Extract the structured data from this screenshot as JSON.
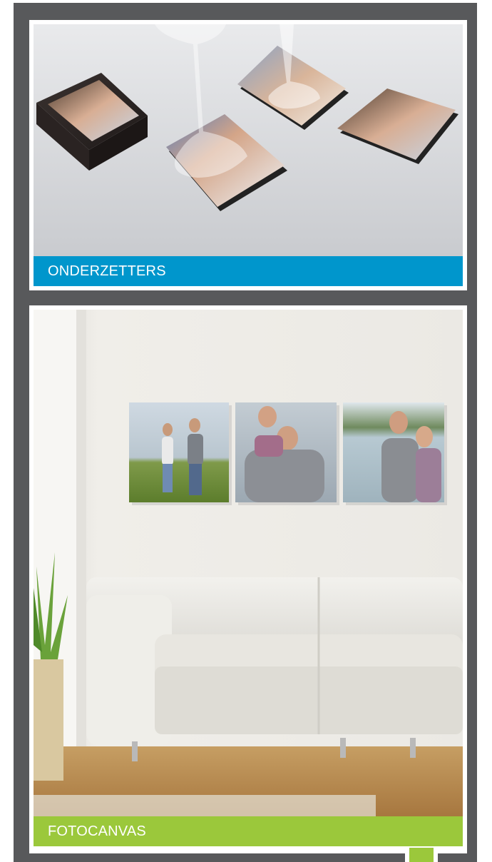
{
  "cards": [
    {
      "label": "ONDERZETTERS",
      "color": "#0096cc"
    },
    {
      "label": "FOTOCANVAS",
      "color": "#9bc83b"
    }
  ],
  "colors": {
    "frame": "#58595b",
    "page_tab": "#9bc83b"
  }
}
